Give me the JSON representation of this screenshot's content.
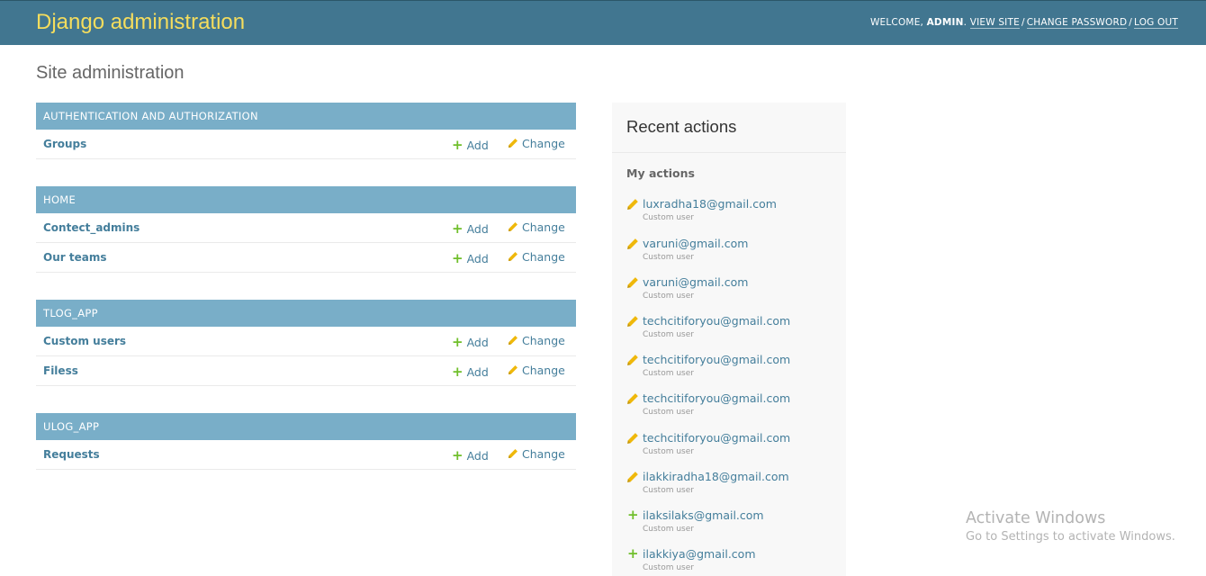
{
  "header": {
    "branding": "Django administration",
    "welcome_prefix": "WELCOME, ",
    "username": "ADMIN",
    "view_site": "VIEW SITE",
    "change_password": "CHANGE PASSWORD",
    "log_out": "LOG OUT"
  },
  "site_title": "Site administration",
  "modules": [
    {
      "caption": "AUTHENTICATION AND AUTHORIZATION",
      "models": [
        {
          "name": "Groups"
        }
      ]
    },
    {
      "caption": "HOME",
      "models": [
        {
          "name": "Contect_admins"
        },
        {
          "name": "Our teams"
        }
      ]
    },
    {
      "caption": "TLOG_APP",
      "models": [
        {
          "name": "Custom users"
        },
        {
          "name": "Filess"
        }
      ]
    },
    {
      "caption": "ULOG_APP",
      "models": [
        {
          "name": "Requests"
        }
      ]
    }
  ],
  "add_label": "Add",
  "change_label": "Change",
  "recent": {
    "title": "Recent actions",
    "my_actions": "My actions",
    "items": [
      {
        "action": "change",
        "label": "luxradha18@gmail.com",
        "type": "Custom user"
      },
      {
        "action": "change",
        "label": "varuni@gmail.com",
        "type": "Custom user"
      },
      {
        "action": "change",
        "label": "varuni@gmail.com",
        "type": "Custom user"
      },
      {
        "action": "change",
        "label": "techcitiforyou@gmail.com",
        "type": "Custom user"
      },
      {
        "action": "change",
        "label": "techcitiforyou@gmail.com",
        "type": "Custom user"
      },
      {
        "action": "change",
        "label": "techcitiforyou@gmail.com",
        "type": "Custom user"
      },
      {
        "action": "change",
        "label": "techcitiforyou@gmail.com",
        "type": "Custom user"
      },
      {
        "action": "change",
        "label": "ilakkiradha18@gmail.com",
        "type": "Custom user"
      },
      {
        "action": "add",
        "label": "ilaksilaks@gmail.com",
        "type": "Custom user"
      },
      {
        "action": "add",
        "label": "ilakkiya@gmail.com",
        "type": "Custom user"
      }
    ]
  },
  "watermark": {
    "title": "Activate Windows",
    "subtitle": "Go to Settings to activate Windows."
  },
  "colors": {
    "header_bg": "#417690",
    "branding": "#f5dd5d",
    "caption_bg": "#79aec8",
    "link": "#447e9b",
    "add_icon": "#70bf2b",
    "change_icon": "#efb80b"
  }
}
